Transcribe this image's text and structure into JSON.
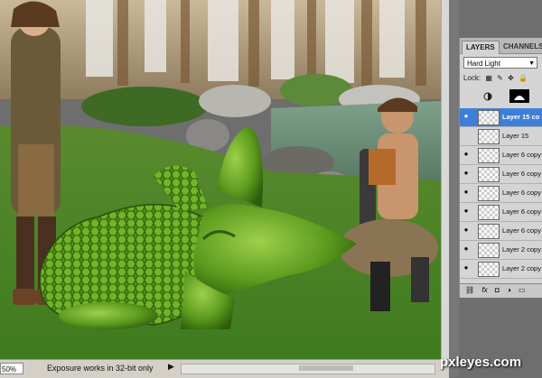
{
  "status": {
    "zoom": "50%",
    "info": "Exposure works in 32-bit only",
    "arrow": "▶"
  },
  "panel": {
    "tabs": [
      "LAYERS",
      "CHANNELS"
    ],
    "blend_mode": "Hard Light",
    "lock_label": "Lock:",
    "layers": [
      {
        "name": "Layer 15 co",
        "visible": true,
        "selected": true
      },
      {
        "name": "Layer 15",
        "visible": false,
        "selected": false
      },
      {
        "name": "Layer 6 copy",
        "visible": true,
        "selected": false
      },
      {
        "name": "Layer 6 copy",
        "visible": true,
        "selected": false
      },
      {
        "name": "Layer 6 copy",
        "visible": true,
        "selected": false
      },
      {
        "name": "Layer 6 copy",
        "visible": true,
        "selected": false
      },
      {
        "name": "Layer 6 copy",
        "visible": true,
        "selected": false
      },
      {
        "name": "Layer 2 copy",
        "visible": true,
        "selected": false
      },
      {
        "name": "Layer 2 copy",
        "visible": true,
        "selected": false
      }
    ],
    "footer_icons": [
      "link-icon",
      "fx-icon",
      "mask-icon",
      "adjustment-icon",
      "folder-icon"
    ]
  },
  "watermark": "pxleyes.com",
  "colors": {
    "selected": "#3d7fd6",
    "panel": "#d4d4d4"
  }
}
